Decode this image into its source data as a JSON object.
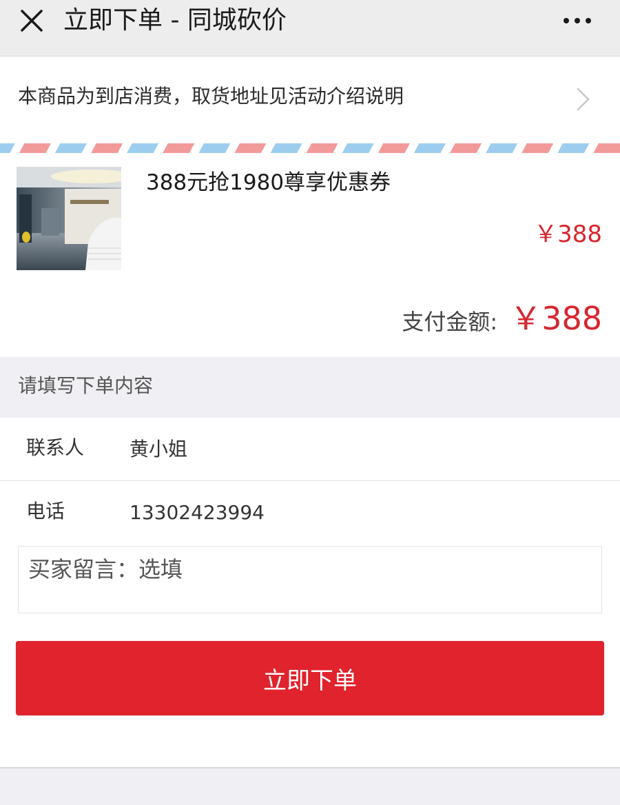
{
  "header": {
    "title": "立即下单 - 同城砍价",
    "close_icon": "close-icon",
    "more_icon": "more-dots-icon",
    "background": "#ededed"
  },
  "notice": {
    "text": "本商品为到店消费，取货地址见活动介绍说明",
    "icon": "chevron-right-icon"
  },
  "product": {
    "name": "388元抢1980尊享优惠券",
    "price": "￥388",
    "image": "store-interior-photo"
  },
  "payment": {
    "label": "支付金额:",
    "amount": "￥388"
  },
  "form": {
    "section_title": "请填写下单内容",
    "contact_label": "联系人",
    "contact_value": "黄小姐",
    "phone_label": "电话",
    "phone_value": "13302423994",
    "message_placeholder": "买家留言：选填"
  },
  "submit": {
    "label": "立即下单"
  },
  "colors": {
    "accent": "#e0232d",
    "price": "#d7262e",
    "airmail_red": "#f2999a",
    "airmail_blue": "#9ccdee"
  }
}
